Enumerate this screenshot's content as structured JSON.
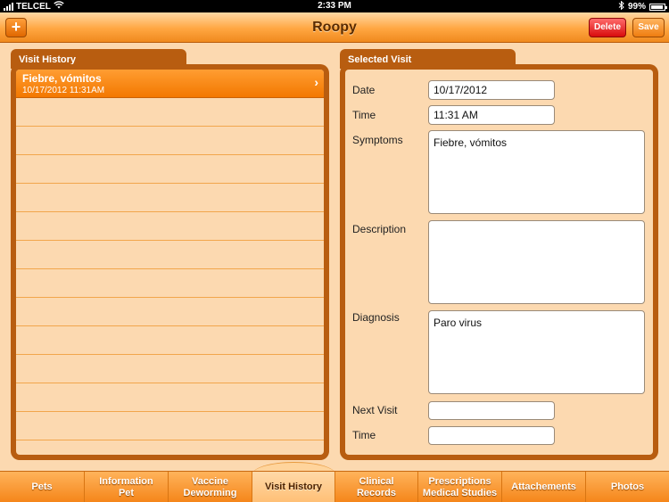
{
  "status_bar": {
    "carrier": "TELCEL",
    "time": "2:33 PM",
    "battery": "99%"
  },
  "header": {
    "title": "Roopy",
    "add_label": "+",
    "delete_label": "Delete",
    "save_label": "Save"
  },
  "visit_history": {
    "title": "Visit History",
    "items": [
      {
        "title": "Fiebre, vómitos",
        "subtitle": "10/17/2012 11:31AM"
      }
    ]
  },
  "selected_visit": {
    "title": "Selected Visit",
    "date_label": "Date",
    "date_value": "10/17/2012",
    "time_label": "Time",
    "time_value": "11:31 AM",
    "symptoms_label": "Symptoms",
    "symptoms_value": "Fiebre, vómitos",
    "description_label": "Description",
    "description_value": "",
    "diagnosis_label": "Diagnosis",
    "diagnosis_value": "Paro virus",
    "next_visit_label": "Next Visit",
    "next_visit_value": "",
    "next_time_label": "Time",
    "next_time_value": ""
  },
  "tabs": [
    {
      "label": "Pets"
    },
    {
      "label": "Information\nPet"
    },
    {
      "label": "Vaccine\nDeworming"
    },
    {
      "label": "Visit History",
      "active": true
    },
    {
      "label": "Clinical\nRecords"
    },
    {
      "label": "Prescriptions\nMedical Studies"
    },
    {
      "label": "Attachements"
    },
    {
      "label": "Photos"
    }
  ]
}
